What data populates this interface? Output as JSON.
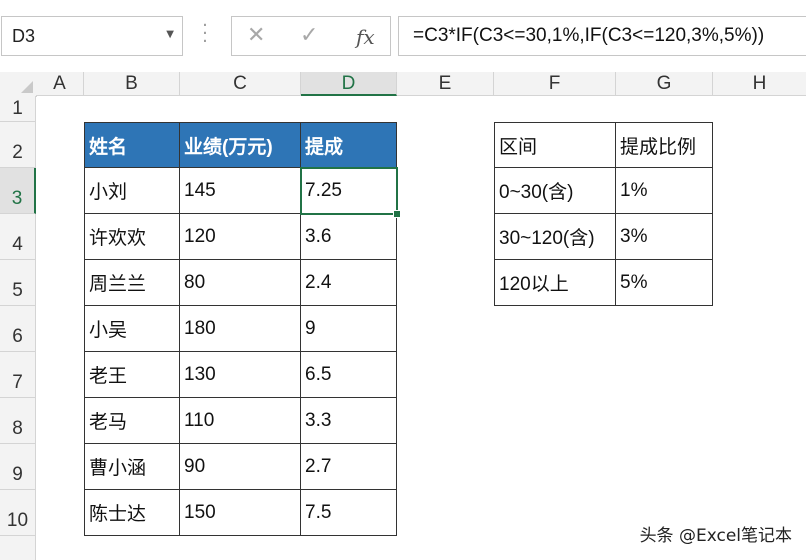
{
  "formula_bar": {
    "name_box": "D3",
    "formula": "=C3*IF(C3<=30,1%,IF(C3<=120,3%,5%))",
    "fx_label": "fx"
  },
  "columns": [
    "A",
    "B",
    "C",
    "D",
    "E",
    "F",
    "G",
    "H"
  ],
  "rows": [
    "1",
    "2",
    "3",
    "4",
    "5",
    "6",
    "7",
    "8",
    "9",
    "10"
  ],
  "table1": {
    "headers": [
      "姓名",
      "业绩(万元)",
      "提成"
    ],
    "rows": [
      [
        "小刘",
        "145",
        "7.25"
      ],
      [
        "许欢欢",
        "120",
        "3.6"
      ],
      [
        "周兰兰",
        "80",
        "2.4"
      ],
      [
        "小吴",
        "180",
        "9"
      ],
      [
        "老王",
        "130",
        "6.5"
      ],
      [
        "老马",
        "110",
        "3.3"
      ],
      [
        "曹小涵",
        "90",
        "2.7"
      ],
      [
        "陈士达",
        "150",
        "7.5"
      ]
    ]
  },
  "table2": {
    "headers": [
      "区间",
      "提成比例"
    ],
    "rows": [
      [
        "0~30(含)",
        "1%"
      ],
      [
        "30~120(含)",
        "3%"
      ],
      [
        "120以上",
        "5%"
      ]
    ]
  },
  "selection": {
    "cell": "D3"
  },
  "colors": {
    "header_fill": "#2e75b6",
    "selection": "#217346"
  },
  "watermark": "头条 @Excel笔记本"
}
